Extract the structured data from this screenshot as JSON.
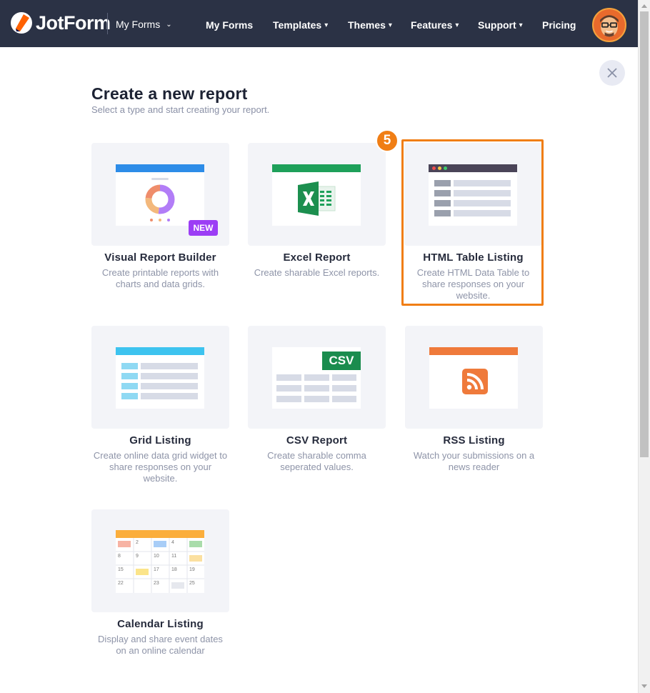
{
  "header": {
    "logo_text": "JotForm",
    "myforms_dropdown": "My Forms",
    "nav": [
      {
        "label": "My Forms",
        "has_caret": false
      },
      {
        "label": "Templates",
        "has_caret": true
      },
      {
        "label": "Themes",
        "has_caret": true
      },
      {
        "label": "Features",
        "has_caret": true
      },
      {
        "label": "Support",
        "has_caret": true
      },
      {
        "label": "Pricing",
        "has_caret": false
      }
    ],
    "caret": "▾",
    "small_caret": "⌄"
  },
  "page": {
    "title": "Create a new report",
    "subtitle": "Select a type and start creating your report.",
    "step_number": "5"
  },
  "cards": [
    {
      "id": "visual",
      "title": "Visual Report Builder",
      "desc": "Create printable reports with charts and data grids.",
      "badge": "NEW",
      "accent": "#2d8ce8"
    },
    {
      "id": "excel",
      "title": "Excel Report",
      "desc": "Create sharable Excel reports.",
      "accent": "#1ea05a"
    },
    {
      "id": "html",
      "title": "HTML Table Listing",
      "desc": "Create HTML Data Table to share responses on your website.",
      "accent": "#4a4458",
      "selected": true
    },
    {
      "id": "grid",
      "title": "Grid Listing",
      "desc": "Create online data grid widget to share responses on your website.",
      "accent": "#3dc3ef"
    },
    {
      "id": "csv",
      "title": "CSV Report",
      "desc": "Create sharable comma seperated values.",
      "badge": "CSV",
      "accent": "#1a8c4e"
    },
    {
      "id": "rss",
      "title": "RSS Listing",
      "desc": "Watch your submissions on a news reader",
      "accent": "#ef7a3b"
    },
    {
      "id": "calendar",
      "title": "Calendar Listing",
      "desc": "Display and share event dates on an online calendar",
      "accent": "#fbae3c"
    }
  ],
  "calendar_numbers": [
    "2",
    "4",
    "8",
    "9",
    "10",
    "11",
    "15",
    "17",
    "18",
    "19",
    "22",
    "23",
    "25"
  ],
  "colors": {
    "header_bg": "#2b3245",
    "highlight": "#f07e15",
    "new_badge": "#9c3ef5"
  }
}
